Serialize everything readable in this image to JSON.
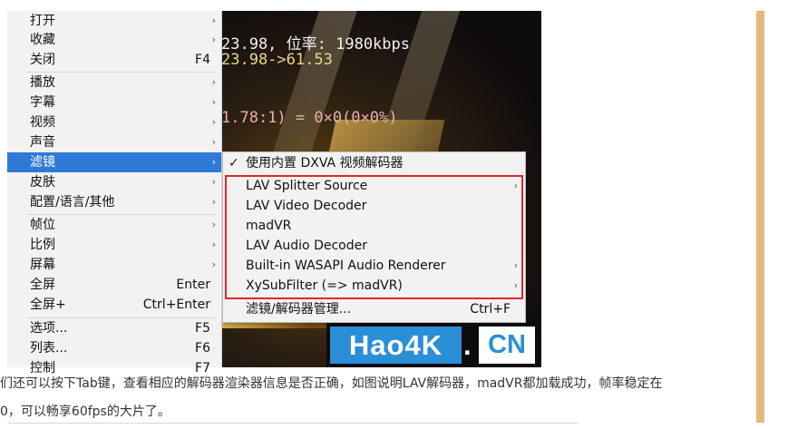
{
  "osd": {
    "line1": "23.98, 位率: 1980kbps",
    "line2": "23.98->61.53",
    "line3": "1.78:1) = 0×0(0×0%)"
  },
  "context_menu": {
    "items": [
      {
        "label": "打开",
        "shortcut": "",
        "arrow": "›"
      },
      {
        "label": "收藏",
        "shortcut": "",
        "arrow": "›"
      },
      {
        "label": "关闭",
        "shortcut": "F4",
        "arrow": ""
      },
      {
        "label": "播放",
        "shortcut": "",
        "arrow": "›"
      },
      {
        "label": "字幕",
        "shortcut": "",
        "arrow": "›"
      },
      {
        "label": "视频",
        "shortcut": "",
        "arrow": "›"
      },
      {
        "label": "声音",
        "shortcut": "",
        "arrow": "›"
      },
      {
        "label": "滤镜",
        "shortcut": "",
        "arrow": "›",
        "selected": true
      },
      {
        "label": "皮肤",
        "shortcut": "",
        "arrow": "›"
      },
      {
        "label": "配置/语言/其他",
        "shortcut": "",
        "arrow": "›"
      },
      {
        "label": "帧位",
        "shortcut": "",
        "arrow": "›"
      },
      {
        "label": "比例",
        "shortcut": "",
        "arrow": "›"
      },
      {
        "label": "屏幕",
        "shortcut": "",
        "arrow": "›"
      },
      {
        "label": "全屏",
        "shortcut": "Enter",
        "arrow": ""
      },
      {
        "label": "全屏+",
        "shortcut": "Ctrl+Enter",
        "arrow": ""
      },
      {
        "label": "选项...",
        "shortcut": "F5",
        "arrow": ""
      },
      {
        "label": "列表...",
        "shortcut": "F6",
        "arrow": ""
      },
      {
        "label": "控制",
        "shortcut": "F7",
        "arrow": ""
      }
    ]
  },
  "filter_submenu": {
    "check": "✓",
    "items": [
      {
        "label": "使用内置 DXVA 视频解码器",
        "shortcut": "",
        "arrow": ""
      },
      {
        "label": "LAV Splitter Source",
        "shortcut": "",
        "arrow": "›"
      },
      {
        "label": "LAV Video Decoder",
        "shortcut": "",
        "arrow": ""
      },
      {
        "label": "madVR",
        "shortcut": "",
        "arrow": ""
      },
      {
        "label": "LAV Audio Decoder",
        "shortcut": "",
        "arrow": ""
      },
      {
        "label": "Built-in WASAPI Audio Renderer",
        "shortcut": "",
        "arrow": "›"
      },
      {
        "label": "XySubFilter (=> madVR)",
        "shortcut": "",
        "arrow": "›"
      },
      {
        "label": "滤镜/解码器管理...",
        "shortcut": "Ctrl+F",
        "arrow": ""
      }
    ]
  },
  "watermark": {
    "part1": "Hao4K",
    "dot": ".",
    "part2": "CN"
  },
  "article": {
    "line1": "们还可以按下Tab键，查看相应的解码器渲染器信息是否正确，如图说明LAV解码器，madVR都加载成功，帧率稳定在",
    "line2": "0，可以畅享60fps的大片了。"
  },
  "colors": {
    "highlight": "#2f7ad6",
    "red_box": "#e0262e",
    "logo_blue": "#2b8fd8",
    "sidebar_accent": "#e8b878"
  }
}
